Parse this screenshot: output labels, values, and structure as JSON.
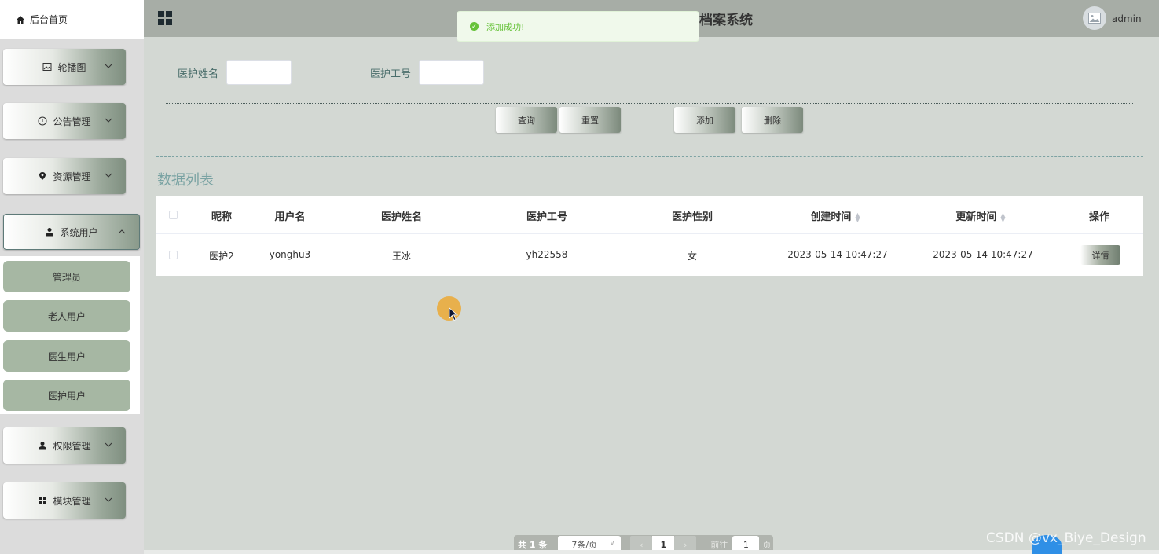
{
  "sidebar": {
    "home_label": "后台首页",
    "menus": [
      {
        "label": "轮播图",
        "icon": "image-icon"
      },
      {
        "label": "公告管理",
        "icon": "info-circle-icon"
      },
      {
        "label": "资源管理",
        "icon": "location-pin-icon"
      },
      {
        "label": "系统用户",
        "icon": "user-icon",
        "expanded": true
      },
      {
        "label": "权限管理",
        "icon": "user-icon"
      },
      {
        "label": "模块管理",
        "icon": "grid-icon"
      }
    ],
    "submenu": [
      {
        "label": "管理员"
      },
      {
        "label": "老人用户"
      },
      {
        "label": "医生用户"
      },
      {
        "label": "医护用户"
      }
    ]
  },
  "header": {
    "title": "档案系统",
    "user": "admin"
  },
  "toast": {
    "message": "添加成功!",
    "color": "#67c23a"
  },
  "search": {
    "name_label": "医护姓名",
    "name_value": "",
    "id_label": "医护工号",
    "id_value": ""
  },
  "actions": {
    "query": "查询",
    "reset": "重置",
    "add": "添加",
    "delete": "删除"
  },
  "list_title": "数据列表",
  "table": {
    "columns": [
      "昵称",
      "用户名",
      "医护姓名",
      "医护工号",
      "医护性别",
      "创建时间",
      "更新时间",
      "操作"
    ],
    "rows": [
      {
        "nickname": "医护2",
        "username": "yonghu3",
        "name": "王冰",
        "staff_id": "yh22558",
        "gender": "女",
        "created": "2023-05-14 10:47:27",
        "updated": "2023-05-14 10:47:27",
        "action": "详情"
      }
    ]
  },
  "pagination": {
    "total": "共 1 条",
    "page_size": "7条/页",
    "current_page": "1",
    "goto_label": "前往",
    "goto_value": "1",
    "page_unit": "页"
  },
  "watermark": "CSDN @vx_Biye_Design",
  "colors": {
    "accent_text": "#7aa3a3",
    "submenu_bg": "#a6b7a3",
    "topbar_bg": "#a7ada6"
  }
}
